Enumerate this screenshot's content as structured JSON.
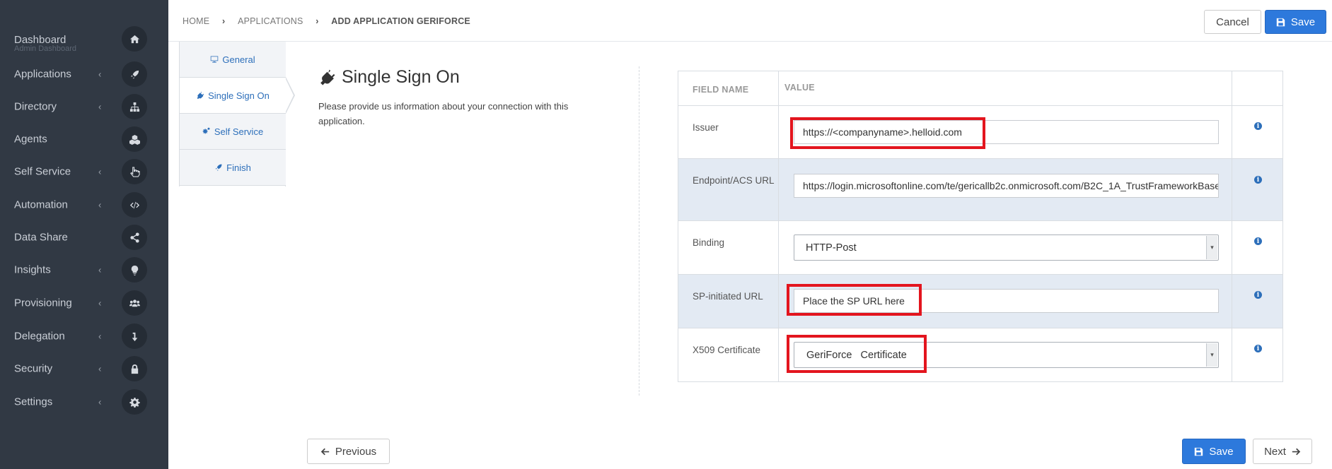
{
  "sidebar": {
    "items": [
      {
        "label": "Dashboard",
        "sub": "Admin Dashboard",
        "chevron": false,
        "icon": "home-icon"
      },
      {
        "label": "Applications",
        "chevron": true,
        "icon": "rocket-icon"
      },
      {
        "label": "Directory",
        "chevron": true,
        "icon": "sitemap-icon"
      },
      {
        "label": "Agents",
        "chevron": false,
        "icon": "cubes-icon"
      },
      {
        "label": "Self Service",
        "chevron": true,
        "icon": "hand-pointer-icon"
      },
      {
        "label": "Automation",
        "chevron": true,
        "icon": "code-icon"
      },
      {
        "label": "Data Share",
        "chevron": false,
        "icon": "share-icon"
      },
      {
        "label": "Insights",
        "chevron": true,
        "icon": "lightbulb-icon"
      },
      {
        "label": "Provisioning",
        "chevron": true,
        "icon": "users-icon"
      },
      {
        "label": "Delegation",
        "chevron": true,
        "icon": "level-down-icon"
      },
      {
        "label": "Security",
        "chevron": true,
        "icon": "lock-icon"
      },
      {
        "label": "Settings",
        "chevron": true,
        "icon": "gear-icon"
      }
    ],
    "chevron_glyph": "‹"
  },
  "breadcrumb": {
    "items": [
      "HOME",
      "APPLICATIONS",
      "ADD APPLICATION GERIFORCE"
    ],
    "separator": "›"
  },
  "toolbar": {
    "cancel_label": "Cancel",
    "save_label": "Save"
  },
  "steps": [
    {
      "label": "General",
      "icon": "desktop-icon",
      "active": false
    },
    {
      "label": "Single Sign On",
      "icon": "plug-icon",
      "active": true
    },
    {
      "label": "Self Service",
      "icon": "gears-icon",
      "active": false
    },
    {
      "label": "Finish",
      "icon": "rocket-icon",
      "active": false
    }
  ],
  "section": {
    "title": "Single Sign On",
    "description": "Please provide us information about your connection with this application."
  },
  "table": {
    "header_field": "FIELD NAME",
    "header_value": "VALUE",
    "rows": [
      {
        "name": "Issuer",
        "value": "https://<companyname>.helloid.com",
        "kind": "input"
      },
      {
        "name": "Endpoint/ACS URL",
        "value": "https://login.microsoftonline.com/te/gericallb2c.onmicrosoft.com/B2C_1A_TrustFrameworkBase",
        "kind": "input"
      },
      {
        "name": "Binding",
        "value": "HTTP-Post",
        "kind": "select"
      },
      {
        "name": "SP-initiated URL",
        "value": "Place the SP URL here",
        "kind": "input"
      },
      {
        "name": "X509 Certificate",
        "value": "GeriForce   Certificate",
        "kind": "select"
      }
    ],
    "info_glyph": "i"
  },
  "footer": {
    "previous_label": "Previous",
    "save_label": "Save",
    "next_label": "Next"
  },
  "colors": {
    "sidebar_bg": "#313944",
    "primary": "#2d79dc",
    "link": "#2d6fba",
    "highlight": "#e3151e",
    "row_shaded": "#e3eaf3"
  }
}
